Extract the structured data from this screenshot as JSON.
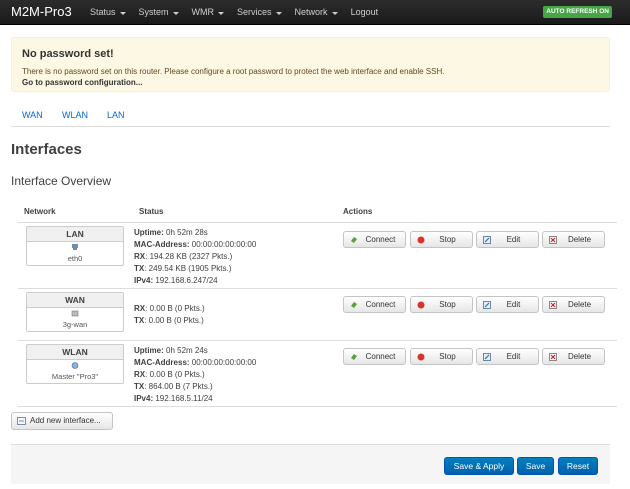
{
  "navbar": {
    "brand": "M2M-Pro3",
    "menu": [
      {
        "label": "Status",
        "has_dropdown": true
      },
      {
        "label": "System",
        "has_dropdown": true
      },
      {
        "label": "WMR",
        "has_dropdown": true
      },
      {
        "label": "Services",
        "has_dropdown": true
      },
      {
        "label": "Network",
        "has_dropdown": true
      },
      {
        "label": "Logout",
        "has_dropdown": false
      }
    ],
    "auto_refresh": "AUTO REFRESH ON"
  },
  "alert": {
    "title": "No password set!",
    "text": "There is no password set on this router. Please configure a root password to protect the web interface and enable SSH.",
    "link": "Go to password configuration..."
  },
  "tabs": [
    "WAN",
    "WLAN",
    "LAN"
  ],
  "page_title": "Interfaces",
  "section_title": "Interface Overview",
  "table": {
    "headers": {
      "network": "Network",
      "status": "Status",
      "actions": "Actions"
    },
    "actions": {
      "connect": "Connect",
      "stop": "Stop",
      "edit": "Edit",
      "delete": "Delete"
    },
    "rows": [
      {
        "name": "LAN",
        "device": "eth0",
        "status": [
          {
            "key": "Uptime:",
            "value": " 0h 52m 28s"
          },
          {
            "key": "MAC-Address:",
            "value": " 00:00:00:00:00:00"
          },
          {
            "key": "RX",
            "value": ": 194.28 KB (2327 Pkts.)"
          },
          {
            "key": "TX",
            "value": ": 249.54 KB (1905 Pkts.)"
          },
          {
            "key": "IPv4:",
            "value": " 192.168.6.247/24"
          }
        ]
      },
      {
        "name": "WAN",
        "device": "3g-wan",
        "status": [
          {
            "key": "RX",
            "value": ": 0.00 B (0 Pkts.)"
          },
          {
            "key": "TX",
            "value": ": 0.00 B (0 Pkts.)"
          }
        ]
      },
      {
        "name": "WLAN",
        "device": "Master \"Pro3\"",
        "status": [
          {
            "key": "Uptime:",
            "value": " 0h 52m 24s"
          },
          {
            "key": "MAC-Address:",
            "value": " 00:00:00:00:00:00"
          },
          {
            "key": "RX",
            "value": ": 0.00 B (0 Pkts.)"
          },
          {
            "key": "TX",
            "value": ": 864.00 B (7 Pkts.)"
          },
          {
            "key": "IPv4:",
            "value": " 192.168.5.11/24"
          }
        ]
      }
    ]
  },
  "add_interface": "Add new interface...",
  "footer": {
    "save_apply": "Save & Apply",
    "save": "Save",
    "reset": "Reset"
  },
  "colors": {
    "accent": "#0069d6",
    "primary_button": "#0480be",
    "alert_bg": "#fcf8e3",
    "auto_refresh": "#46a546"
  }
}
